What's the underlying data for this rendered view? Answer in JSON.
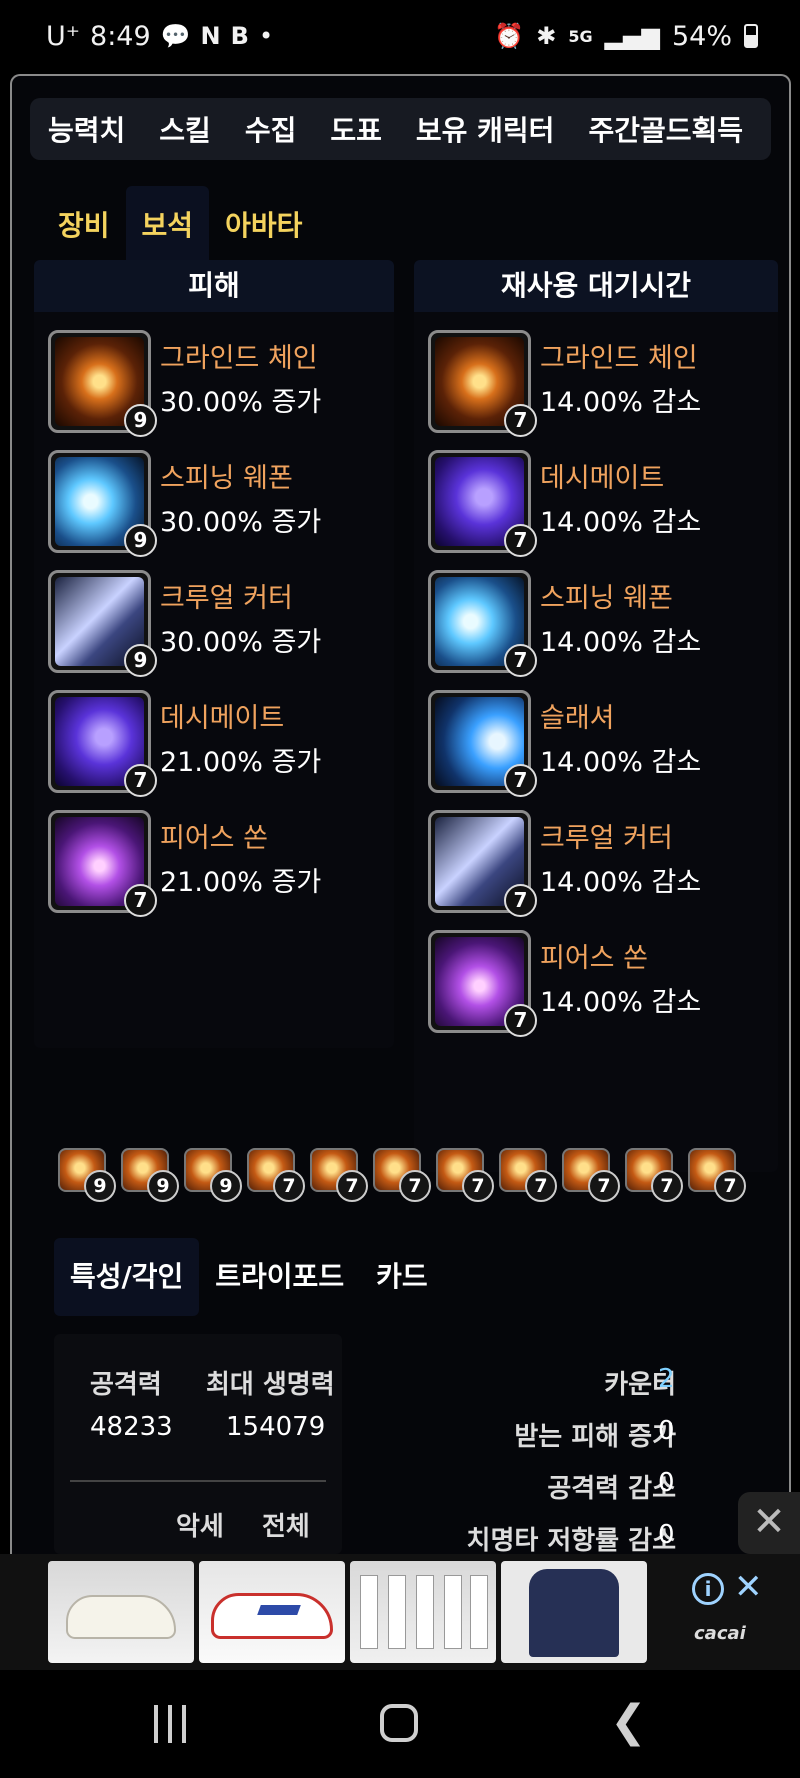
{
  "status_bar": {
    "carrier": "U⁺",
    "time": "8:49",
    "network": "5G",
    "battery": "54%"
  },
  "top_tabs": [
    "능력치",
    "스킬",
    "수집",
    "도표",
    "보유 캐릭터",
    "주간골드획득"
  ],
  "sub_tabs": [
    "장비",
    "보석",
    "아바타"
  ],
  "damage_panel": {
    "title": "피해",
    "gems": [
      {
        "name": "그라인드 체인",
        "value": "30.00% 증가",
        "level": "9",
        "icon": "grind-chain-icon"
      },
      {
        "name": "스피닝 웨폰",
        "value": "30.00% 증가",
        "level": "9",
        "icon": "spinning-weapon-icon"
      },
      {
        "name": "크루얼 커터",
        "value": "30.00% 증가",
        "level": "9",
        "icon": "cruel-cutter-icon"
      },
      {
        "name": "데시메이트",
        "value": "21.00% 증가",
        "level": "7",
        "icon": "decimate-icon"
      },
      {
        "name": "피어스 쏜",
        "value": "21.00% 증가",
        "level": "7",
        "icon": "pierce-thorn-icon"
      }
    ]
  },
  "cooldown_panel": {
    "title": "재사용 대기시간",
    "gems": [
      {
        "name": "그라인드 체인",
        "value": "14.00% 감소",
        "level": "7",
        "icon": "grind-chain-icon"
      },
      {
        "name": "데시메이트",
        "value": "14.00% 감소",
        "level": "7",
        "icon": "decimate-icon"
      },
      {
        "name": "스피닝 웨폰",
        "value": "14.00% 감소",
        "level": "7",
        "icon": "spinning-weapon-icon"
      },
      {
        "name": "슬래셔",
        "value": "14.00% 감소",
        "level": "7",
        "icon": "slasher-icon"
      },
      {
        "name": "크루얼 커터",
        "value": "14.00% 감소",
        "level": "7",
        "icon": "cruel-cutter-icon"
      },
      {
        "name": "피어스 쏜",
        "value": "14.00% 감소",
        "level": "7",
        "icon": "pierce-thorn-icon"
      }
    ]
  },
  "gem_strip": [
    "9",
    "9",
    "9",
    "7",
    "7",
    "7",
    "7",
    "7",
    "7",
    "7",
    "7"
  ],
  "bottom_tabs": [
    "특성/각인",
    "트라이포드",
    "카드"
  ],
  "stats": {
    "attack_label": "공격력",
    "hp_label": "최대 생명력",
    "attack_value": "48233",
    "hp_value": "154079",
    "col1": "악세",
    "col2": "전체"
  },
  "counters": [
    {
      "label": "카운터",
      "value": "2"
    },
    {
      "label": "받는 피해 증가",
      "value": "0"
    },
    {
      "label": "공격력 감소",
      "value": "0"
    },
    {
      "label": "치명타 저항률 감소",
      "value": "0"
    }
  ],
  "ad": {
    "logo": "cacai"
  }
}
